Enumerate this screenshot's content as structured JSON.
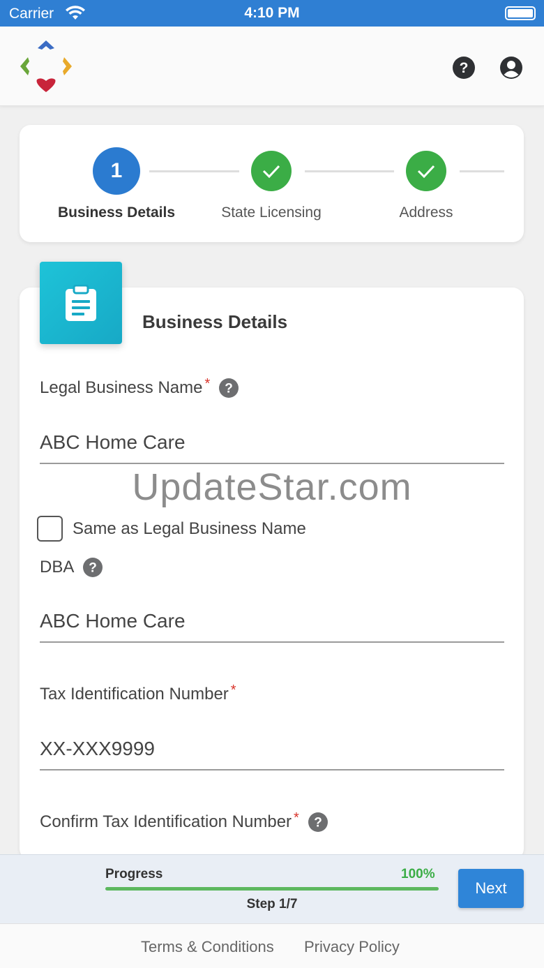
{
  "status_bar": {
    "carrier": "Carrier",
    "time": "4:10 PM"
  },
  "header": {
    "help_icon": "question-circle-icon",
    "user_icon": "user-circle-icon"
  },
  "stepper": {
    "steps": [
      {
        "number": "1",
        "label": "Business Details",
        "state": "active"
      },
      {
        "label": "State Licensing",
        "state": "done"
      },
      {
        "label": "Address",
        "state": "done"
      }
    ]
  },
  "form": {
    "title": "Business Details",
    "legal_name": {
      "label": "Legal Business Name",
      "required": "*",
      "value": "ABC Home Care"
    },
    "same_as_legal": {
      "label": "Same as Legal Business Name",
      "checked": false
    },
    "dba": {
      "label": "DBA",
      "value": "ABC Home Care"
    },
    "tax_id": {
      "label": "Tax Identification Number",
      "required": "*",
      "value": "XX-XXX9999"
    },
    "confirm_tax_id": {
      "label": "Confirm Tax Identification Number",
      "required": "*"
    }
  },
  "watermark": "UpdateStar.com",
  "progress": {
    "label": "Progress",
    "percent_text": "100%",
    "percent": 100,
    "step_text": "Step 1/7",
    "next_label": "Next"
  },
  "footer": {
    "terms": "Terms & Conditions",
    "privacy": "Privacy Policy"
  },
  "colors": {
    "primary": "#2f7fd3",
    "success": "#3bad46",
    "required": "#d9342b",
    "accent": "#1ec3d8"
  }
}
